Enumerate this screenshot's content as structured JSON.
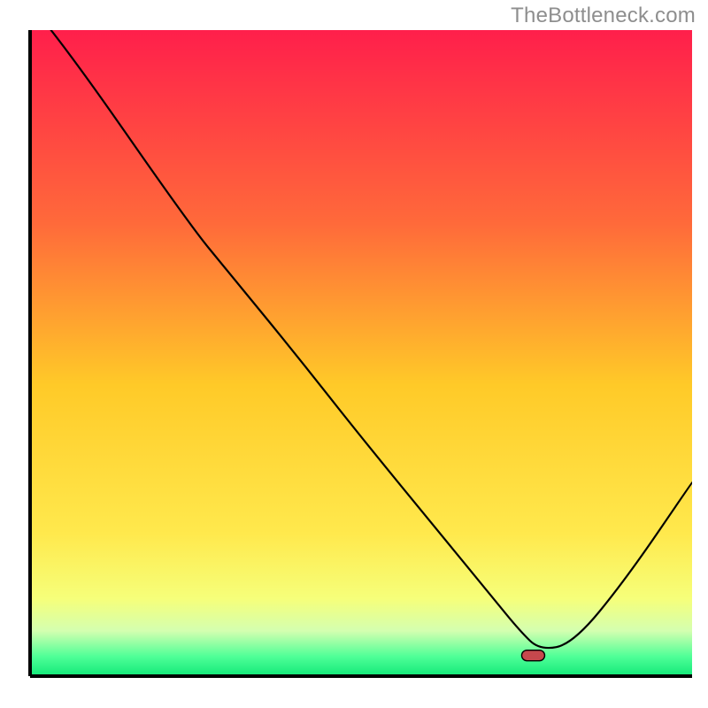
{
  "watermark": "TheBottleneck.com",
  "chart_data": {
    "type": "line",
    "title": "",
    "xlabel": "",
    "ylabel": "",
    "xlim": [
      0,
      100
    ],
    "ylim": [
      0,
      100
    ],
    "series": [
      {
        "name": "bottleneck-curve",
        "x": [
          0,
          5,
          24,
          30,
          40,
          50,
          62,
          66,
          70,
          74,
          77,
          82,
          90,
          100
        ],
        "y": [
          104,
          98,
          70,
          62.5,
          50,
          37,
          22,
          17,
          12,
          7,
          4,
          5,
          15,
          30
        ]
      }
    ],
    "highlight_point": {
      "x": 76,
      "y": 3.2
    },
    "gradient_stops": [
      {
        "offset": 0.0,
        "color": "#ff1f4b"
      },
      {
        "offset": 0.3,
        "color": "#ff6a3a"
      },
      {
        "offset": 0.55,
        "color": "#ffca28"
      },
      {
        "offset": 0.78,
        "color": "#ffe94d"
      },
      {
        "offset": 0.88,
        "color": "#f6ff7a"
      },
      {
        "offset": 0.93,
        "color": "#d4ffb0"
      },
      {
        "offset": 0.97,
        "color": "#4eff97"
      },
      {
        "offset": 1.0,
        "color": "#12e878"
      }
    ]
  }
}
